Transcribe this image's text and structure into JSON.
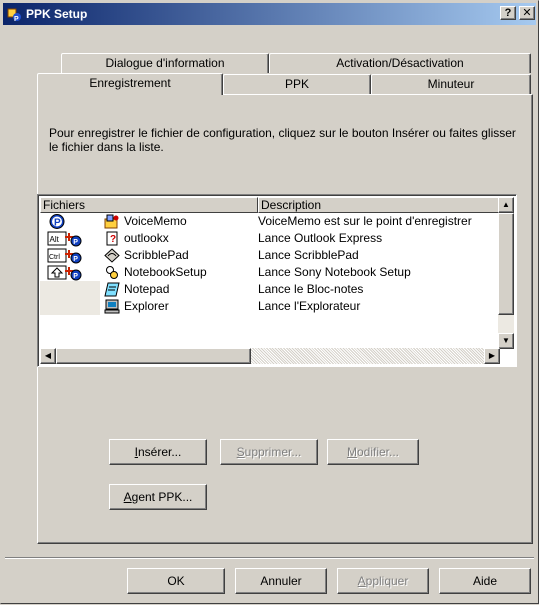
{
  "window": {
    "title": "PPK Setup",
    "help_button": "?",
    "close_button": "✕"
  },
  "tabs": {
    "row_back": [
      "Dialogue d'information",
      "Activation/Désactivation"
    ],
    "row_front": [
      "Enregistrement",
      "PPK",
      "Minuteur"
    ],
    "active": "Enregistrement"
  },
  "instructions": "Pour enregistrer le fichier de configuration, cliquez sur le bouton Insérer ou faites glisser le fichier dans la liste.",
  "list": {
    "columns": [
      "Fichiers",
      "Description"
    ],
    "rows": [
      {
        "key": "P",
        "name": "VoiceMemo",
        "desc": "VoiceMemo est sur le point d'enregistrer"
      },
      {
        "key": "Alt",
        "name": "outlookx",
        "desc": "Lance Outlook Express"
      },
      {
        "key": "Ctrl",
        "name": "ScribblePad",
        "desc": "Lance ScribblePad"
      },
      {
        "key": "Shift",
        "name": "NotebookSetup",
        "desc": "Lance Sony Notebook Setup"
      },
      {
        "key": "",
        "name": "Notepad",
        "desc": "Lance le Bloc-notes"
      },
      {
        "key": "",
        "name": "Explorer",
        "desc": "Lance l'Explorateur"
      }
    ]
  },
  "buttons": {
    "insert": {
      "mnemonic": "I",
      "rest": "nsérer..."
    },
    "delete": {
      "mnemonic": "S",
      "rest": "upprimer..."
    },
    "modify": {
      "mnemonic": "M",
      "rest": "odifier..."
    },
    "agent": {
      "mnemonic": "A",
      "rest": "gent PPK..."
    }
  },
  "footer": {
    "ok": "OK",
    "cancel": "Annuler",
    "apply": {
      "mnemonic": "A",
      "rest": "ppliquer"
    },
    "help": "Aide"
  },
  "colors": {
    "title_start": "#0a246a",
    "title_end": "#a6caf0",
    "face": "#d4d0c8",
    "badge_red": "#cc2200",
    "badge_blue": "#1040c0"
  }
}
